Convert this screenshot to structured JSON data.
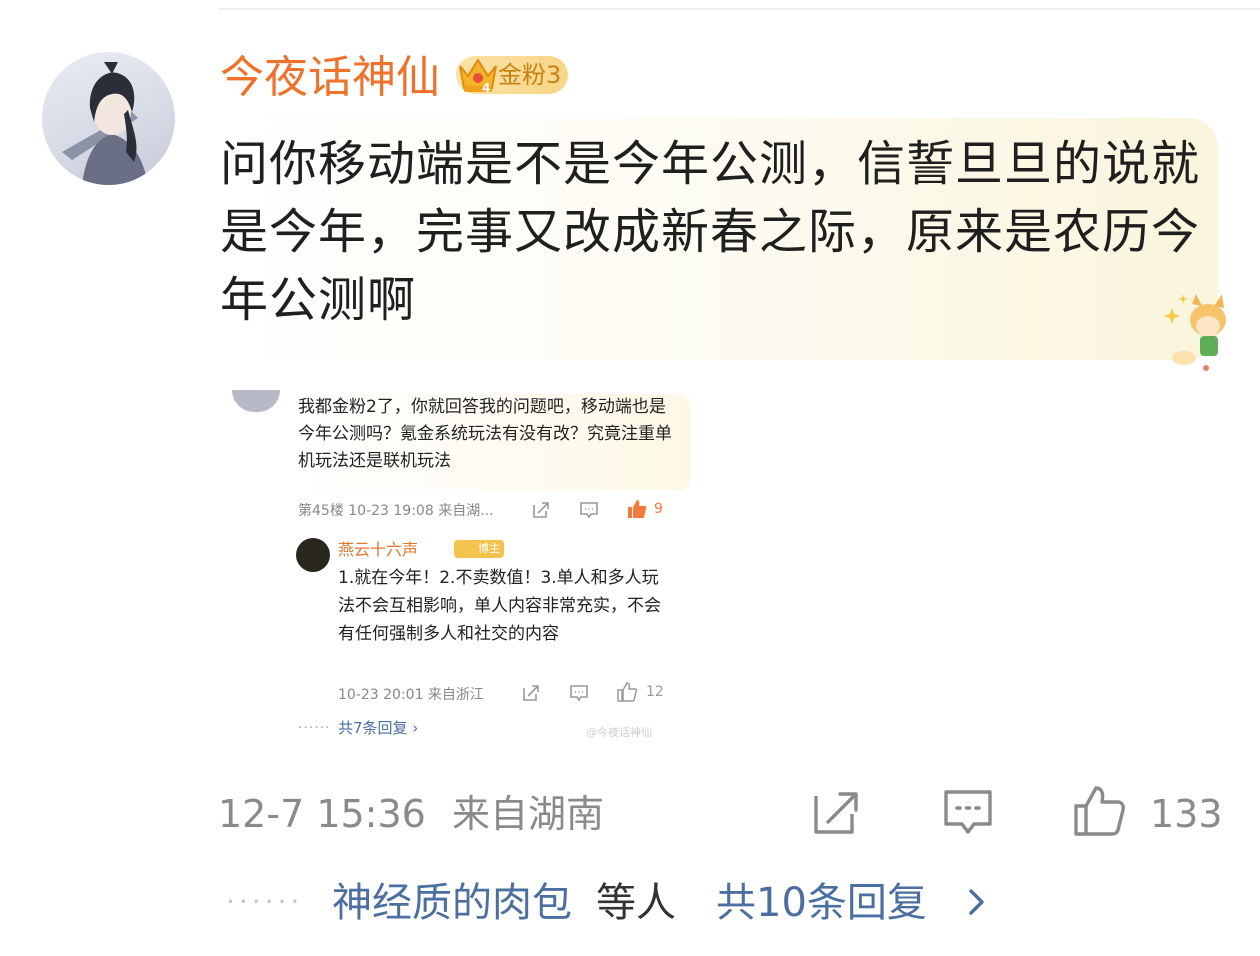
{
  "post": {
    "username": "今夜话神仙",
    "fan_badge": "金粉3",
    "badge_level": "4",
    "comment_text": "问你移动端是不是今年公测，信誓旦旦的说就是今年，完事又改成新春之际，原来是农历今年公测啊",
    "timestamp": "12-7 15:36",
    "location": "来自湖南",
    "like_count": "133",
    "reply_names": "神经质的肉包",
    "reply_names_suffix": "等人",
    "total_replies": "共10条回复"
  },
  "embedded_screenshot": {
    "question_text": "我都金粉2了，你就回答我的问题吧，移动端也是今年公测吗？氪金系统玩法有没有改？究竟注重单机玩法还是联机玩法",
    "question_meta": "第45楼  10-23 19:08  来自湖...",
    "question_likes": "9",
    "replier_name": "燕云十六声",
    "replier_tag": "博主",
    "reply_text": "1.就在今年！2.不卖数值！3.单人和多人玩法不会互相影响，单人内容非常充实，不会有任何强制多人和社交的内容",
    "reply_meta": "10-23 20:01  来自浙江",
    "reply_likes": "12",
    "more_replies": "共7条回复 ›",
    "watermark": "@今夜话神仙"
  },
  "colors": {
    "username": "#f0722a",
    "link_blue": "#4a6fa0",
    "meta_gray": "#8a8a8a",
    "badge_gold": "#f8d586"
  }
}
